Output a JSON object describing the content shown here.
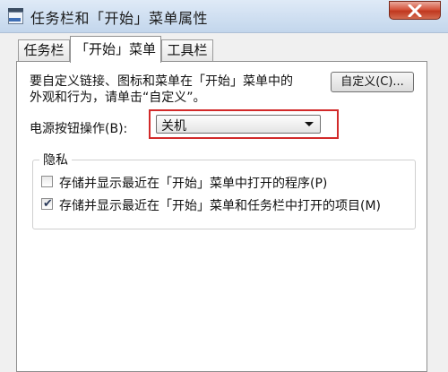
{
  "window": {
    "title": "任务栏和「开始」菜单属性"
  },
  "tabs": [
    {
      "label": "任务栏"
    },
    {
      "label": "「开始」菜单"
    },
    {
      "label": "工具栏"
    }
  ],
  "start_menu": {
    "description_line1": "要自定义链接、图标和菜单在「开始」菜单中的",
    "description_line2": "外观和行为，请单击“自定义”。",
    "customize_button": "自定义(C)...",
    "power_button_label": "电源按钮操作(B):",
    "power_button_value": "关机",
    "privacy": {
      "title": "隐私",
      "options": [
        {
          "label": "存储并显示最近在「开始」菜单中打开的程序(P)",
          "checked": false
        },
        {
          "label": "存储并显示最近在「开始」菜单和任务栏中打开的项目(M)",
          "checked": true
        }
      ]
    }
  },
  "icons": {
    "app": "taskbar-properties-icon",
    "close": "close-icon",
    "dropdown": "chevron-down-icon",
    "checkmark": "checkmark-icon"
  },
  "colors": {
    "highlight_border": "#d22a2a",
    "close_button": "#c84a33"
  }
}
